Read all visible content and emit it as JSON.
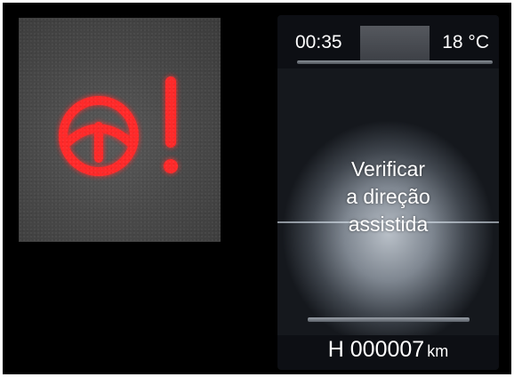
{
  "warning_lamp": {
    "icon": "power-steering-warning-icon",
    "color": "#ff2a2a"
  },
  "cluster": {
    "time": "00:35",
    "temperature": "18 °C",
    "message_lines": [
      "Verificar",
      "a direção",
      "assistida"
    ],
    "odometer": {
      "prefix": "H",
      "value": "000007",
      "unit": "km"
    }
  }
}
